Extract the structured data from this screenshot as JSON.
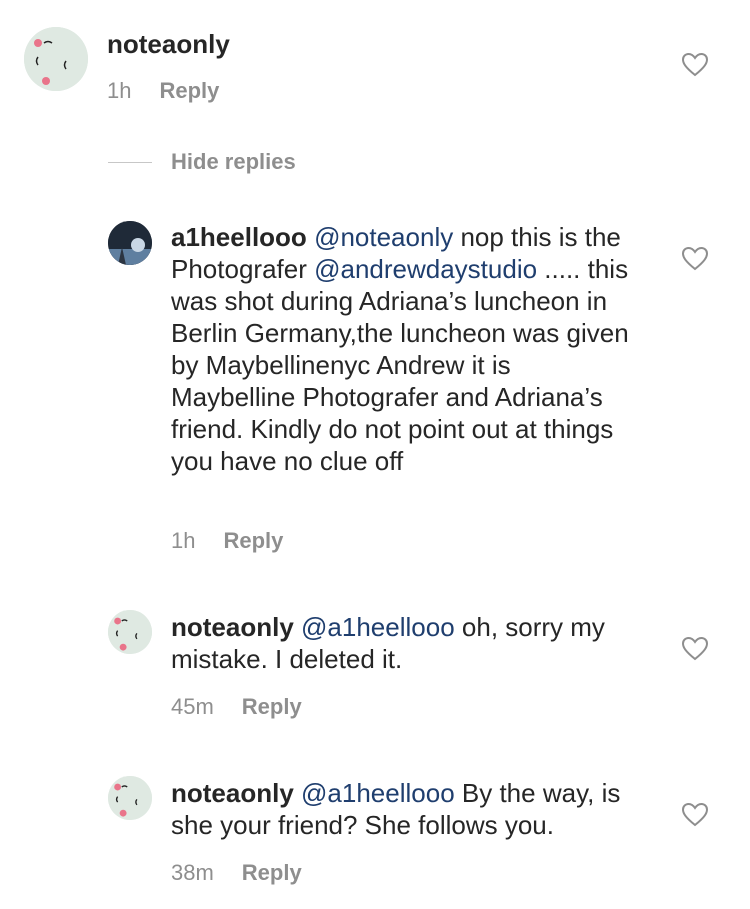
{
  "comments": [
    {
      "username": "noteaonly",
      "parts": [],
      "time": "1h",
      "reply_label": "Reply",
      "avatar": "face-sleepy-avatar"
    },
    {
      "username": "a1heellooo",
      "parts": [
        {
          "type": "mention",
          "text": "@noteaonly"
        },
        {
          "type": "text",
          "text": " nop this is the Photografer "
        },
        {
          "type": "mention",
          "text": "@andrewdaystudio"
        },
        {
          "type": "text",
          "text": " ..... this was shot during Adriana’s luncheon in Berlin Germany,the luncheon was given by Maybellinenyc Andrew it is Maybelline Photografer and Adriana’s friend. Kindly do not point out at things you have no clue off"
        }
      ],
      "time": "1h",
      "reply_label": "Reply",
      "avatar": "landscape-avatar"
    },
    {
      "username": "noteaonly",
      "parts": [
        {
          "type": "mention",
          "text": "@a1heellooo"
        },
        {
          "type": "text",
          "text": " oh, sorry my mistake. I deleted it."
        }
      ],
      "time": "45m",
      "reply_label": "Reply",
      "avatar": "face-sleepy-avatar"
    },
    {
      "username": "noteaonly",
      "parts": [
        {
          "type": "mention",
          "text": "@a1heellooo"
        },
        {
          "type": "text",
          "text": " By the way, is she your friend? She follows you."
        }
      ],
      "time": "38m",
      "reply_label": "Reply",
      "avatar": "face-sleepy-avatar"
    }
  ],
  "hide_replies_label": "Hide replies",
  "colors": {
    "mention": "#1f3e6e",
    "meta": "#8e8e8e",
    "text": "#262626"
  }
}
